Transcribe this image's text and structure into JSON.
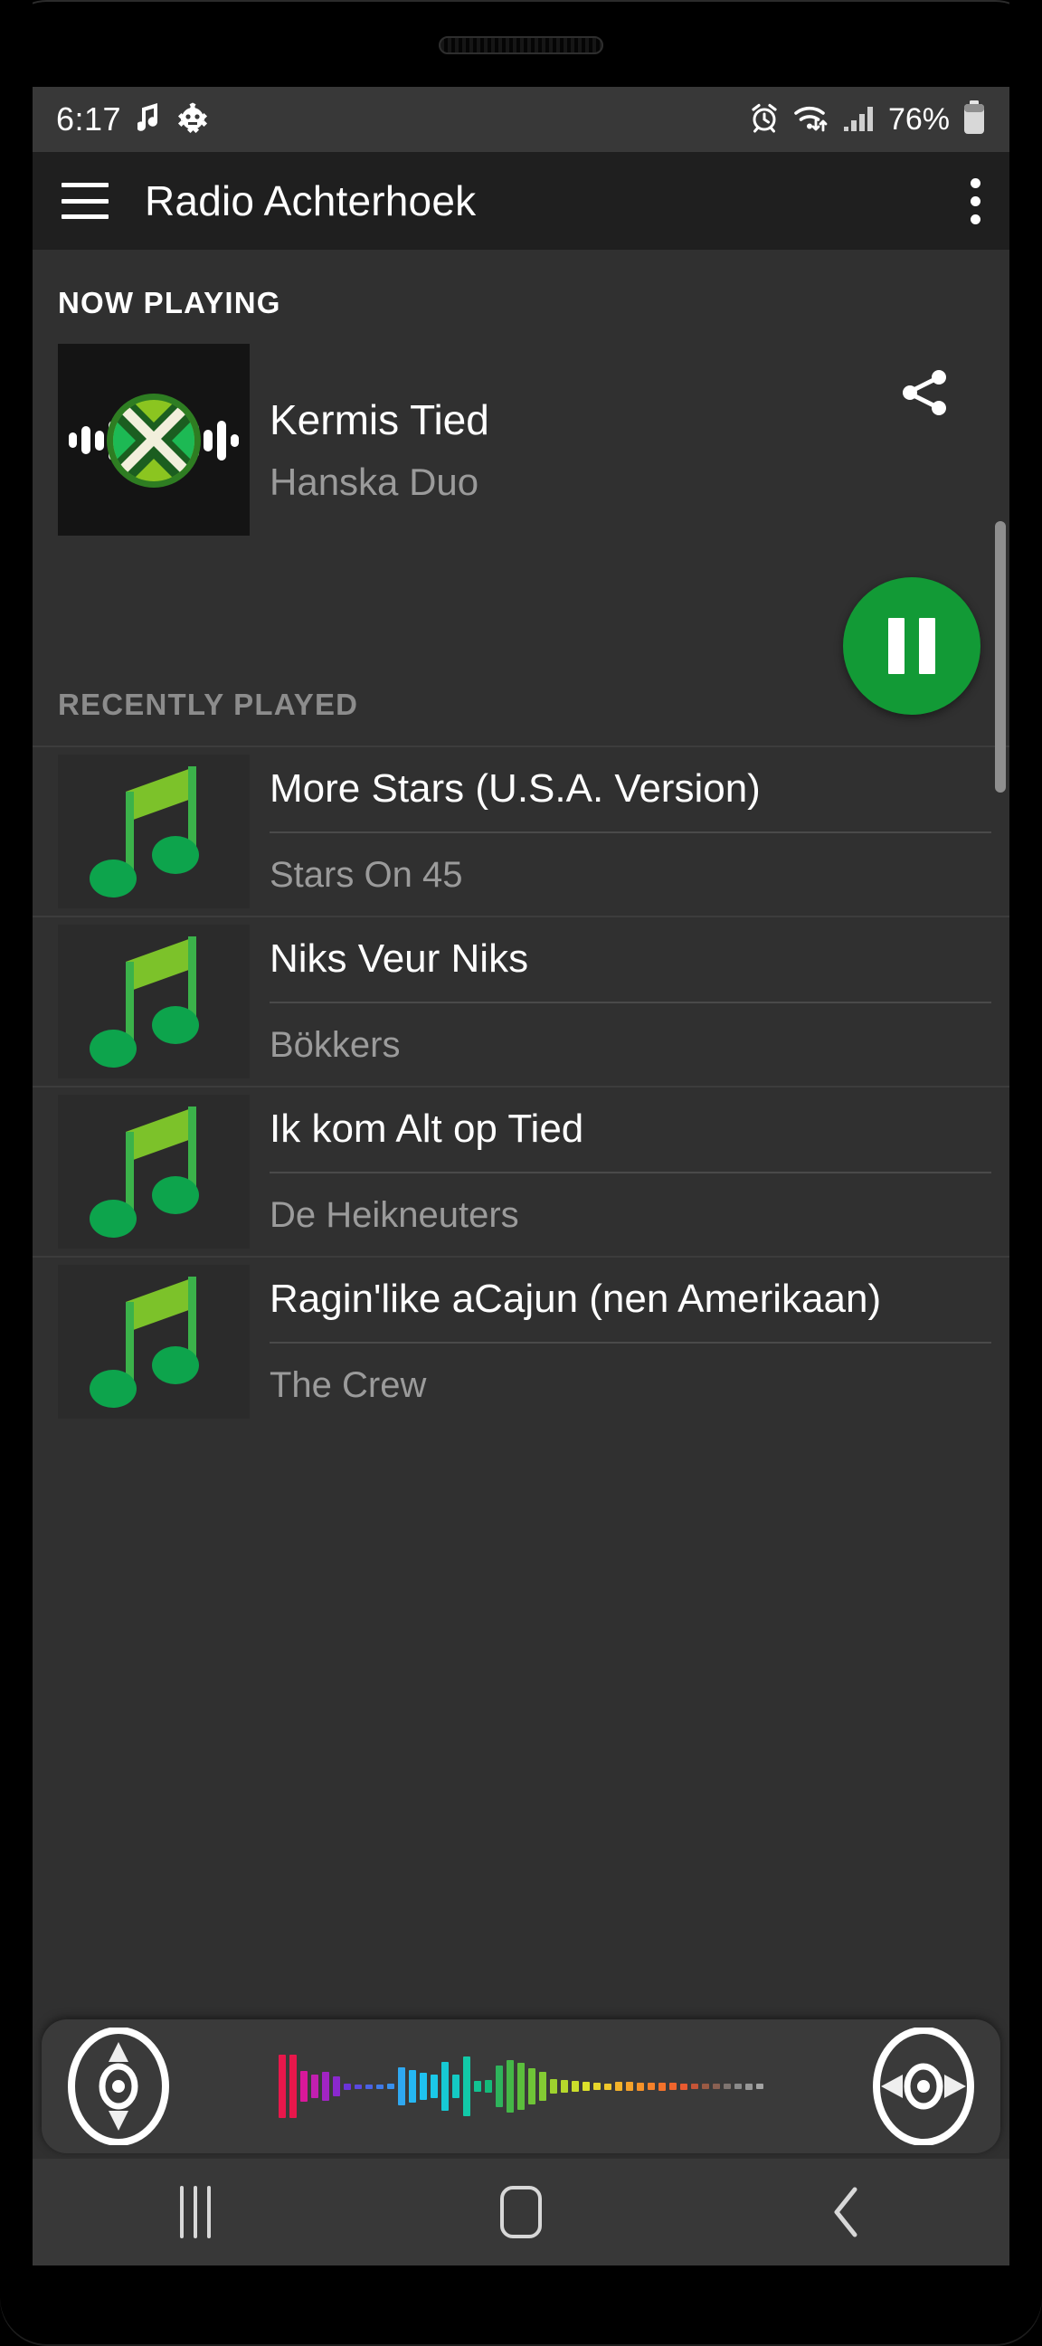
{
  "statusbar": {
    "time": "6:17",
    "battery_percent": "76%",
    "icons": [
      "music-note-icon",
      "android-bug-icon",
      "alarm-icon",
      "wifi-icon",
      "signal-icon",
      "battery-icon"
    ]
  },
  "appbar": {
    "menu_icon": "hamburger-menu-icon",
    "title": "Radio Achterhoek",
    "overflow_icon": "overflow-menu-icon"
  },
  "now_playing": {
    "section_label": "NOW PLAYING",
    "title": "Kermis Tied",
    "artist": "Hanska Duo",
    "share_icon": "share-icon",
    "album_art": "radio-achterhoek-logo",
    "playback_state": "playing",
    "fab_icon": "pause-icon"
  },
  "recently_played": {
    "section_label": "RECENTLY PLAYED",
    "tracks": [
      {
        "title": "More Stars (U.S.A. Version)",
        "artist": "Stars On 45",
        "art_icon": "music-note-icon"
      },
      {
        "title": "Niks Veur Niks",
        "artist": "Bökkers",
        "art_icon": "music-note-icon"
      },
      {
        "title": "Ik kom Alt op Tied",
        "artist": "De Heikneuters",
        "art_icon": "music-note-icon"
      },
      {
        "title": "Ragin'like aCajun (nen Amerikaan)",
        "artist": "The Crew",
        "art_icon": "music-note-icon"
      }
    ]
  },
  "player_bar": {
    "left_icon": "vinyl-record-icon",
    "right_icon": "vinyl-record-icon",
    "visualizer": "audio-spectrum-visualizer"
  },
  "navbar": {
    "recents_icon": "recents-icon",
    "home_icon": "home-icon",
    "back_icon": "back-icon"
  },
  "colors": {
    "accent_green": "#129A36",
    "note_green_light": "#7AC943",
    "note_green_dark": "#12A94A",
    "screen_bg": "#303030",
    "appbar_bg": "#1f1f1f",
    "statusbar_bg": "#383838",
    "text_primary": "#ffffff",
    "text_secondary": "#9b9b9b"
  }
}
